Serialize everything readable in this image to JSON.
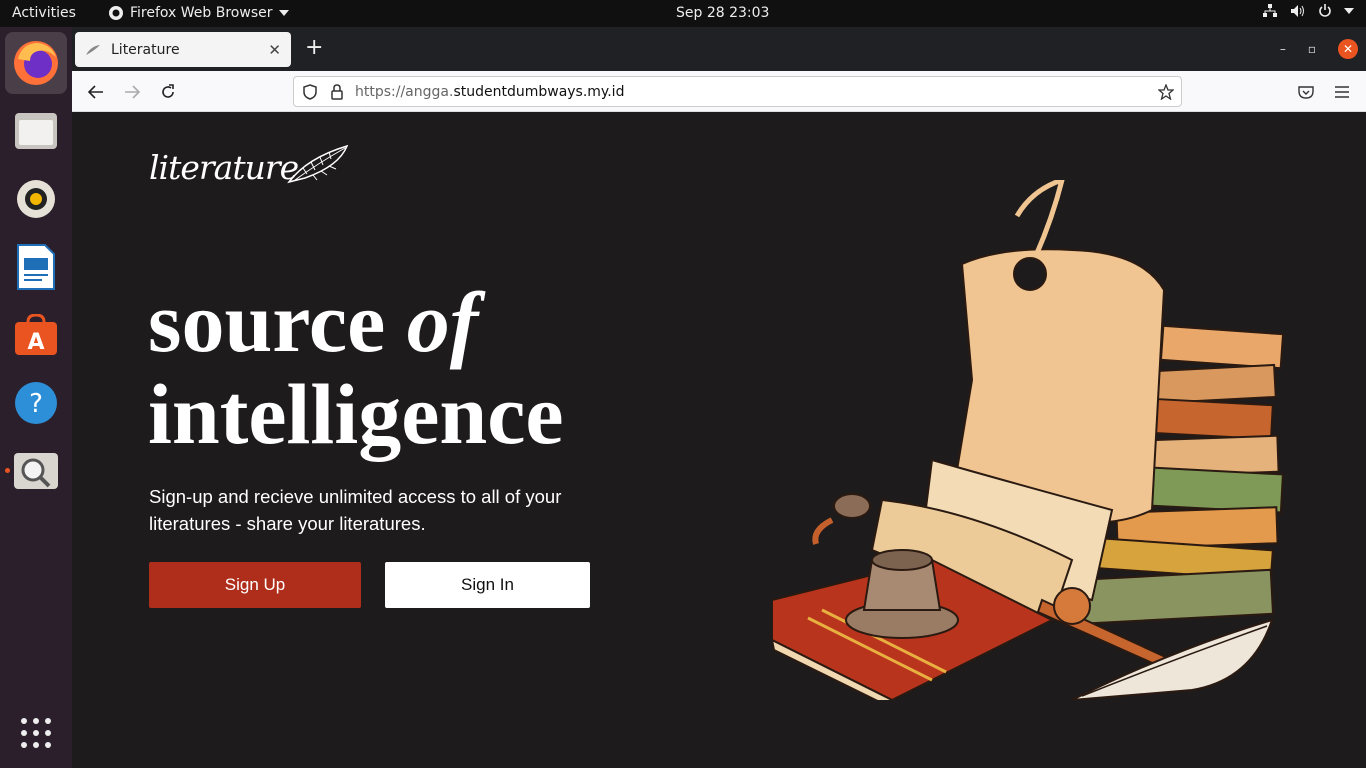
{
  "os": {
    "activities": "Activities",
    "app_name": "Firefox Web Browser",
    "clock": "Sep 28  23:03"
  },
  "browser": {
    "tab_title": "Literature",
    "url_prefix": "https://angga.",
    "url_domain": "studentdumbways.my.id"
  },
  "page": {
    "logo": "literature",
    "headline_word1": "source",
    "headline_word2": "of",
    "headline_word3": "intelligence",
    "subtitle": "Sign-up and recieve unlimited access to all of your literatures - share your literatures.",
    "signup_label": "Sign Up",
    "signin_label": "Sign In"
  },
  "colors": {
    "page_bg": "#1d1b1b",
    "signup_bg": "#af2e1b",
    "accent_orange": "#e95420"
  }
}
